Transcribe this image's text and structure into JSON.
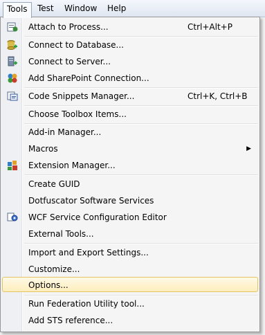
{
  "menubar": {
    "items": [
      {
        "label": "Tools",
        "active": true
      },
      {
        "label": "Test"
      },
      {
        "label": "Window"
      },
      {
        "label": "Help"
      }
    ]
  },
  "menu": {
    "items": [
      {
        "label": "Attach to Process...",
        "shortcut": "Ctrl+Alt+P",
        "icon": "attach-process-icon"
      },
      {
        "label": "Connect to Database...",
        "icon": "database-connect-icon"
      },
      {
        "label": "Connect to Server...",
        "icon": "server-connect-icon"
      },
      {
        "label": "Add SharePoint Connection...",
        "icon": "sharepoint-icon"
      },
      {
        "label": "Code Snippets Manager...",
        "shortcut": "Ctrl+K, Ctrl+B",
        "icon": "snippets-icon"
      },
      {
        "label": "Choose Toolbox Items..."
      },
      {
        "label": "Add-in Manager..."
      },
      {
        "label": "Macros",
        "submenu": true
      },
      {
        "label": "Extension Manager...",
        "icon": "extension-manager-icon"
      },
      {
        "label": "Create GUID"
      },
      {
        "label": "Dotfuscator Software Services"
      },
      {
        "label": "WCF Service Configuration Editor",
        "icon": "wcf-editor-icon"
      },
      {
        "label": "External Tools..."
      },
      {
        "label": "Import and Export Settings..."
      },
      {
        "label": "Customize..."
      },
      {
        "label": "Options...",
        "highlighted": true
      },
      {
        "label": "Run Federation Utility tool..."
      },
      {
        "label": "Add STS reference..."
      }
    ]
  }
}
